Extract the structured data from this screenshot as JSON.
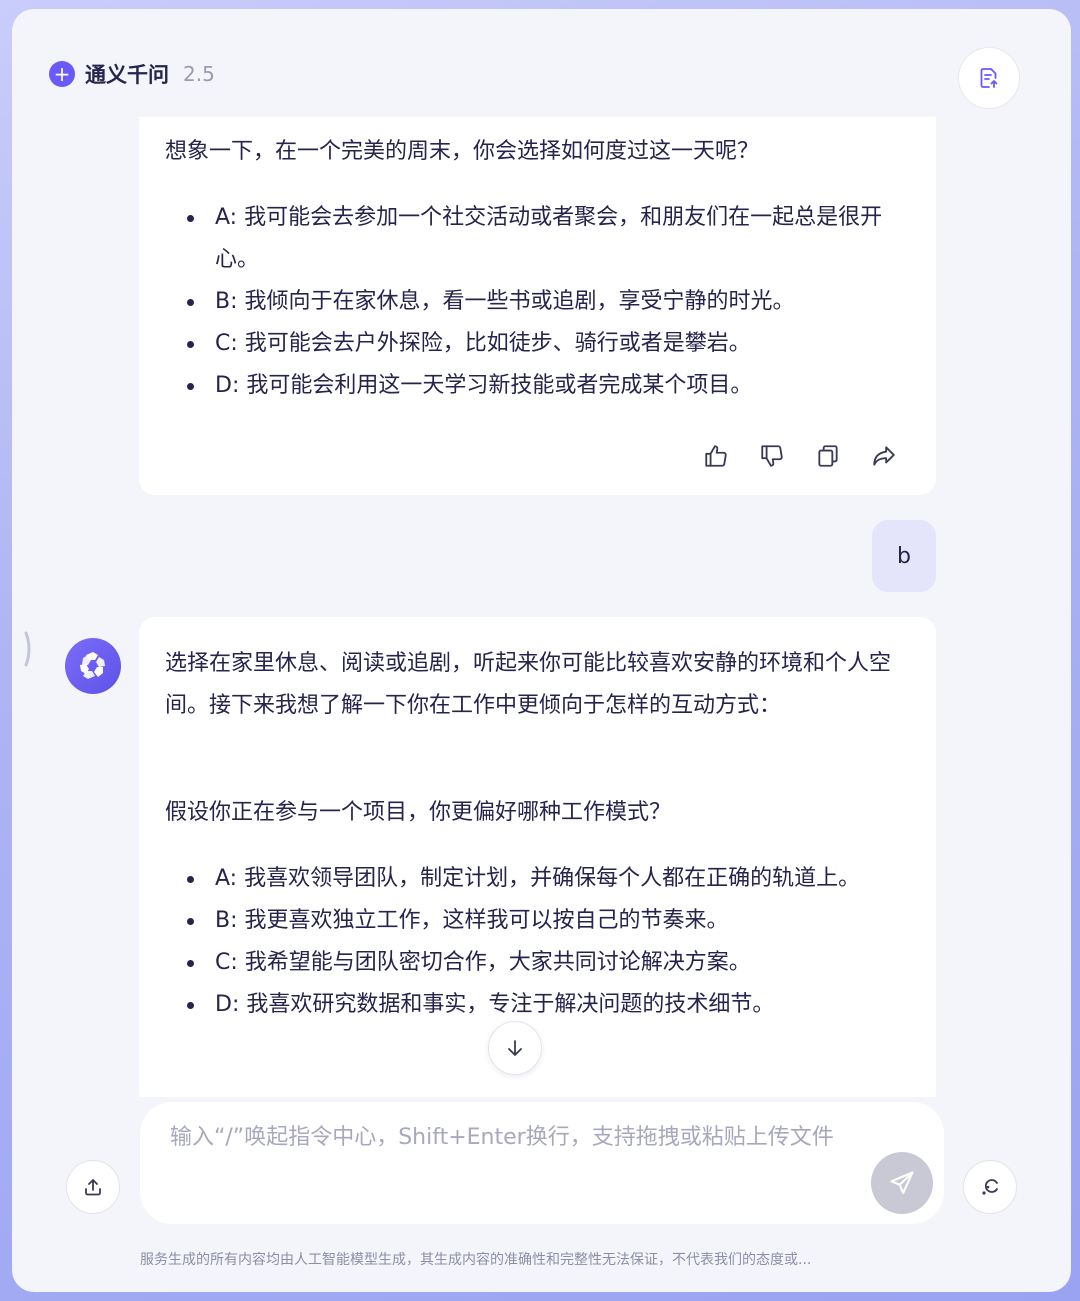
{
  "header": {
    "app_name": "通义千问",
    "version": "2.5"
  },
  "message1": {
    "question": "想象一下，在一个完美的周末，你会选择如何度过这一天呢？",
    "options": [
      "A: 我可能会去参加一个社交活动或者聚会，和朋友们在一起总是很开心。",
      "B: 我倾向于在家休息，看一些书或追剧，享受宁静的时光。",
      "C: 我可能会去户外探险，比如徒步、骑行或者是攀岩。",
      "D: 我可能会利用这一天学习新技能或者完成某个项目。"
    ]
  },
  "user_reply": "b",
  "message2": {
    "intro": "选择在家里休息、阅读或追剧，听起来你可能比较喜欢安静的环境和个人空间。接下来我想了解一下你在工作中更倾向于怎样的互动方式：",
    "question": "假设你正在参与一个项目，你更偏好哪种工作模式？",
    "options": [
      "A: 我喜欢领导团队，制定计划，并确保每个人都在正确的轨道上。",
      "B: 我更喜欢独立工作，这样我可以按自己的节奏来。",
      "C: 我希望能与团队密切合作，大家共同讨论解决方案。",
      "D: 我喜欢研究数据和事实，专注于解决问题的技术细节。"
    ]
  },
  "input": {
    "placeholder": "输入“/”唤起指令中心，Shift+Enter换行，支持拖拽或粘贴上传文件"
  },
  "footer": {
    "disclaimer": "服务生成的所有内容均由人工智能模型生成，其生成内容的准确性和完整性无法保证，不代表我们的态度或..."
  },
  "colors": {
    "accent": "#6a5af9",
    "user_bubble": "#e4e5fb",
    "send_disabled": "#c9c9d6"
  }
}
